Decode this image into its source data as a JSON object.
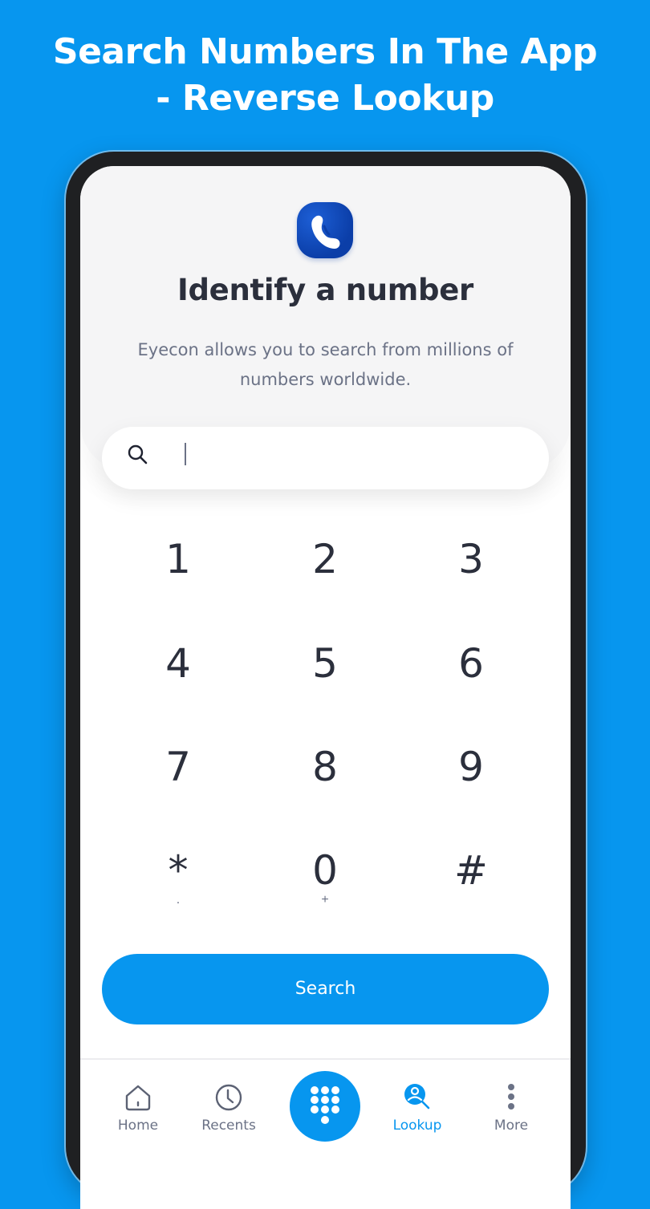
{
  "banner": {
    "line1": "Search Numbers In The App",
    "line2": "- Reverse Lookup"
  },
  "colors": {
    "brand_blue": "#0796ef",
    "app_icon_blue": "#0b3ea8",
    "text_dark": "#2b2f3c",
    "text_muted": "#6b7286"
  },
  "lookup": {
    "app_icon": "phone-handset-icon",
    "title": "Identify a number",
    "subtitle": "Eyecon allows you to search from millions of numbers worldwide.",
    "search_input": {
      "value": "",
      "icon": "search-icon"
    }
  },
  "keypad": {
    "keys": [
      {
        "digit": "1",
        "sub": ""
      },
      {
        "digit": "2",
        "sub": ""
      },
      {
        "digit": "3",
        "sub": ""
      },
      {
        "digit": "4",
        "sub": ""
      },
      {
        "digit": "5",
        "sub": ""
      },
      {
        "digit": "6",
        "sub": ""
      },
      {
        "digit": "7",
        "sub": ""
      },
      {
        "digit": "8",
        "sub": ""
      },
      {
        "digit": "9",
        "sub": ""
      },
      {
        "digit": "*",
        "sub": "."
      },
      {
        "digit": "0",
        "sub": "+"
      },
      {
        "digit": "#",
        "sub": ""
      }
    ]
  },
  "search_button": {
    "label": "Search"
  },
  "bottom_nav": {
    "items": [
      {
        "label": "Home",
        "icon": "home-icon",
        "active": false
      },
      {
        "label": "Recents",
        "icon": "clock-icon",
        "active": false
      },
      {
        "label": "",
        "icon": "dialpad-icon",
        "active": false
      },
      {
        "label": "Lookup",
        "icon": "person-search-icon",
        "active": true
      },
      {
        "label": "More",
        "icon": "more-vertical-icon",
        "active": false
      }
    ]
  }
}
